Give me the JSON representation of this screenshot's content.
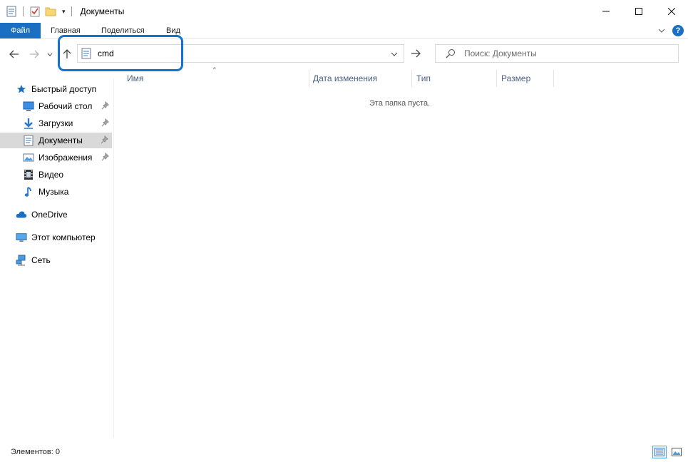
{
  "window": {
    "title": "Документы",
    "controls": {
      "minimize": "—",
      "maximize": "☐",
      "close": "✕"
    }
  },
  "ribbon": {
    "tabs": [
      {
        "label": "Файл"
      },
      {
        "label": "Главная"
      },
      {
        "label": "Поделиться"
      },
      {
        "label": "Вид"
      }
    ],
    "expand_icon": "chevron-down-icon",
    "help_label": "?"
  },
  "nav": {
    "address_value": "cmd",
    "search_placeholder": "Поиск: Документы"
  },
  "sidebar": {
    "items": [
      {
        "label": "Быстрый доступ",
        "icon": "star-icon"
      },
      {
        "label": "Рабочий стол",
        "icon": "desktop-icon",
        "pinned": true
      },
      {
        "label": "Загрузки",
        "icon": "download-icon",
        "pinned": true
      },
      {
        "label": "Документы",
        "icon": "documents-icon",
        "pinned": true,
        "selected": true
      },
      {
        "label": "Изображения",
        "icon": "pictures-icon",
        "pinned": true
      },
      {
        "label": "Видео",
        "icon": "video-icon"
      },
      {
        "label": "Музыка",
        "icon": "music-icon"
      },
      {
        "label": "OneDrive",
        "icon": "cloud-icon"
      },
      {
        "label": "Этот компьютер",
        "icon": "computer-icon"
      },
      {
        "label": "Сеть",
        "icon": "network-icon"
      }
    ]
  },
  "columns": [
    {
      "label": "Имя"
    },
    {
      "label": "Дата изменения"
    },
    {
      "label": "Тип"
    },
    {
      "label": "Размер"
    }
  ],
  "content": {
    "empty_text": "Эта папка пуста."
  },
  "status": {
    "items_text": "Элементов: 0"
  },
  "colors": {
    "accent": "#1a6fc2",
    "highlight": "#1173cf",
    "selection": "#d9d9d9"
  }
}
